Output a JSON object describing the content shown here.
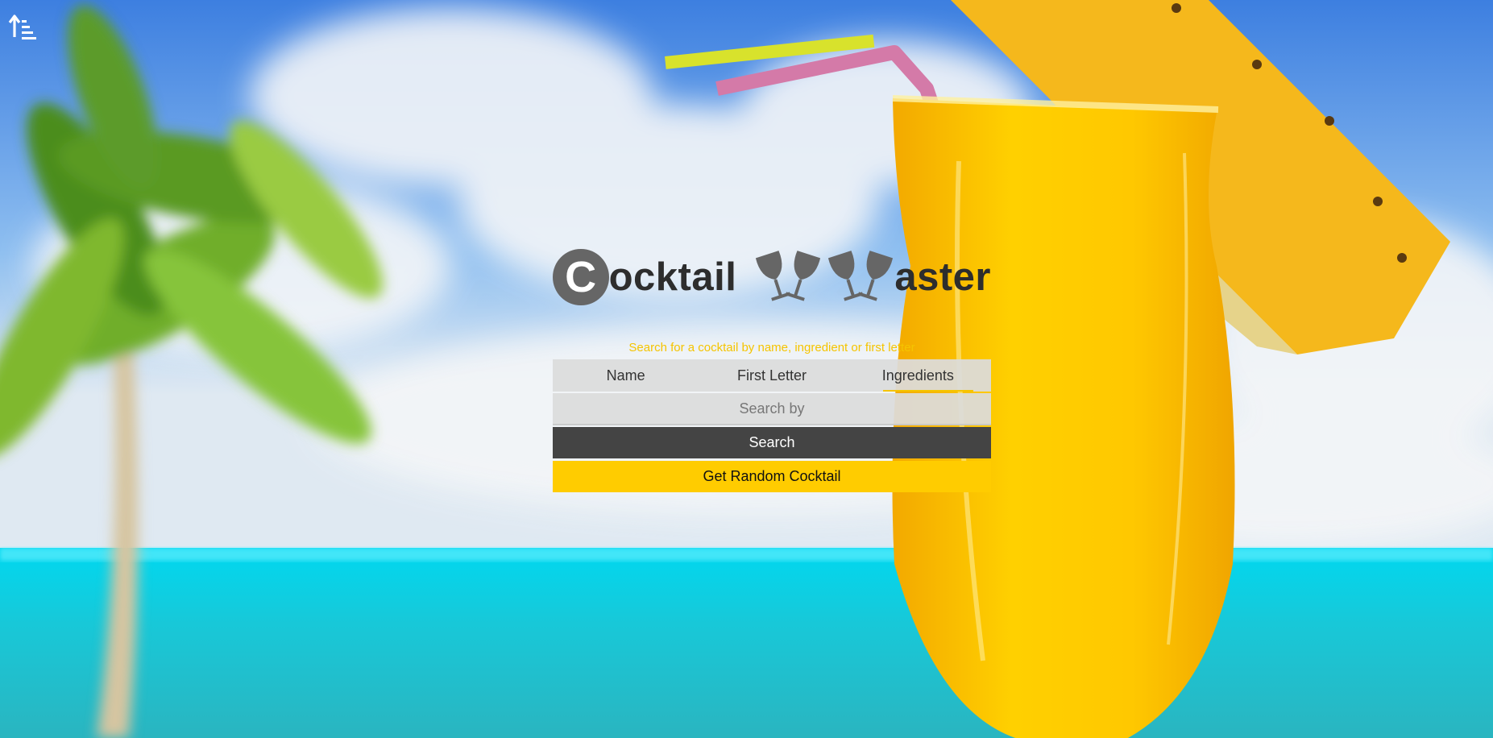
{
  "menu": {
    "icon": "sort-menu-icon"
  },
  "logo": {
    "first_letter": "C",
    "part1": "ocktail",
    "icon": "cheers-glasses-icon",
    "part2": "aster"
  },
  "subtitle": "Search for a cocktail by name, ingredient or first letter",
  "tabs": [
    {
      "label": "Name",
      "active": false
    },
    {
      "label": "First Letter",
      "active": false
    },
    {
      "label": "Ingredients",
      "active": true
    }
  ],
  "search": {
    "placeholder": "Search by",
    "value": ""
  },
  "buttons": {
    "search_label": "Search",
    "random_label": "Get Random Cocktail"
  },
  "colors": {
    "accent": "#ffcc00",
    "dark_button": "#444444",
    "tab_background": "#dcdcdc",
    "logo_text": "#2d2d2d"
  }
}
